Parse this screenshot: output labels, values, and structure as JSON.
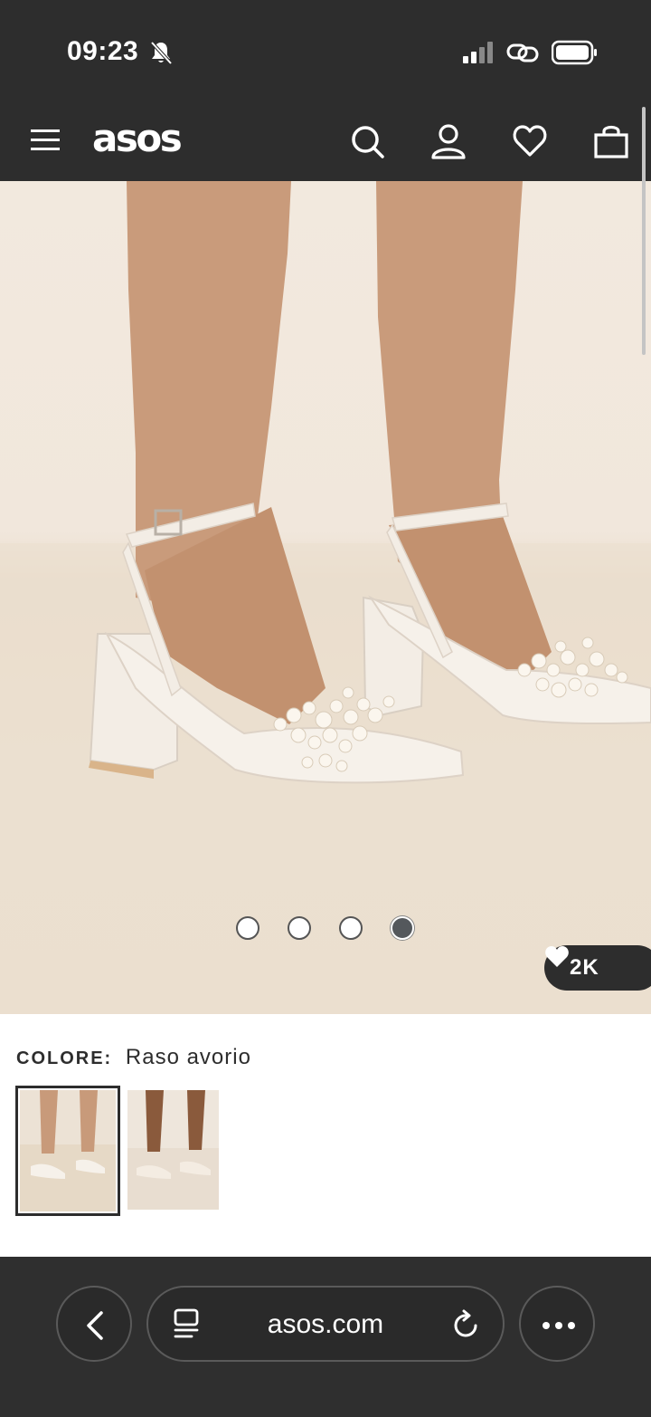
{
  "status_bar": {
    "time": "09:23",
    "icons": [
      "bell-off-icon",
      "signal-icon",
      "link-icon",
      "battery-icon"
    ]
  },
  "header": {
    "logo": "asos",
    "icons": [
      "menu-icon",
      "search-icon",
      "account-icon",
      "wishlist-heart-icon",
      "shopping-bag-icon"
    ]
  },
  "gallery": {
    "slide_count": 4,
    "active_slide": 4,
    "likes": "2K"
  },
  "colour": {
    "label": "COLORE:",
    "value": "Raso avorio",
    "swatches": 2,
    "selected": 1
  },
  "browser": {
    "url": "asos.com"
  },
  "colors": {
    "bar": "#2d2d2d",
    "background": "#f1e7dc"
  }
}
